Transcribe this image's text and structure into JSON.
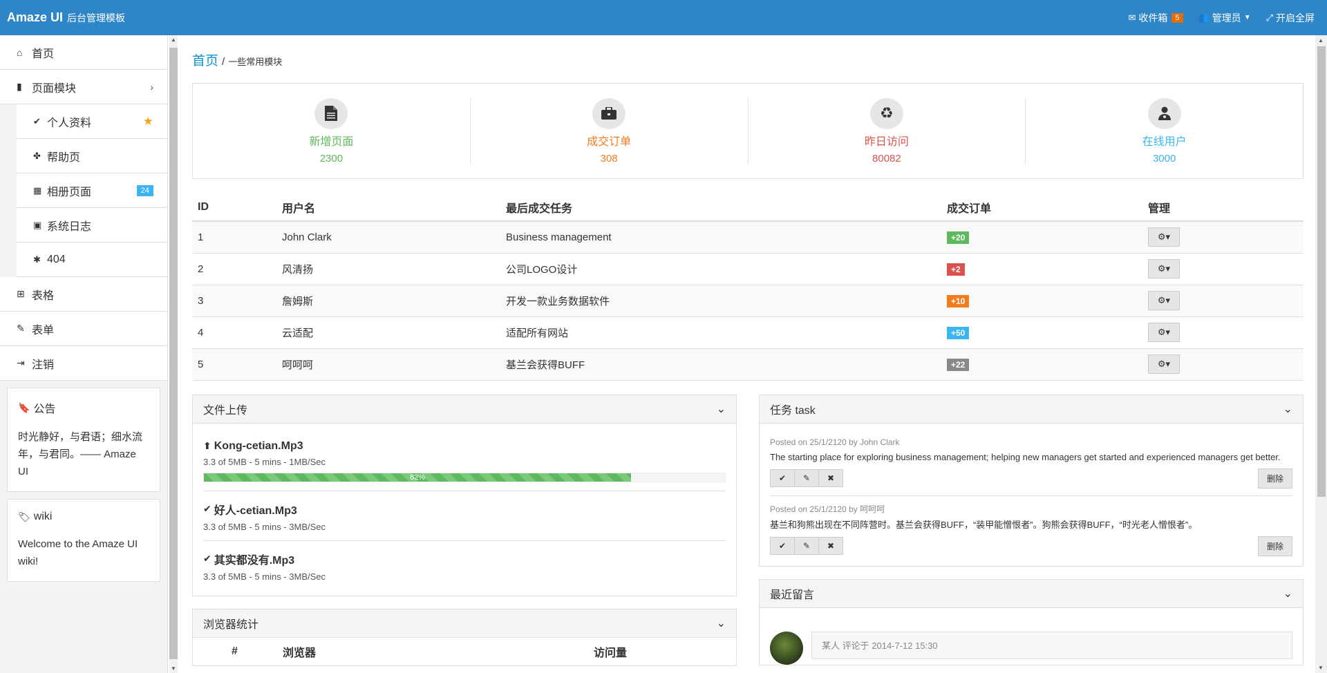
{
  "header": {
    "brand": "Amaze UI",
    "brand_sub": "后台管理模板",
    "inbox_label": "收件箱",
    "inbox_count": "5",
    "admin_label": "管理员",
    "fullscreen_label": "开启全屏"
  },
  "sidebar": {
    "items": [
      {
        "label": "首页",
        "icon": "home-icon"
      },
      {
        "label": "页面模块",
        "icon": "file-icon"
      }
    ],
    "sub_items": [
      {
        "label": "个人资料",
        "icon": "check-icon"
      },
      {
        "label": "帮助页",
        "icon": "puzzle-icon"
      },
      {
        "label": "相册页面",
        "icon": "th-icon",
        "badge": "24"
      },
      {
        "label": "系统日志",
        "icon": "calendar-icon"
      },
      {
        "label": "404",
        "icon": "bug-icon"
      }
    ],
    "items2": [
      {
        "label": "表格",
        "icon": "table-icon"
      },
      {
        "label": "表单",
        "icon": "edit-icon"
      },
      {
        "label": "注销",
        "icon": "sign-out-icon"
      }
    ],
    "notice": {
      "title": "公告",
      "text": "时光静好，与君语；细水流年，与君同。—— Amaze UI"
    },
    "wiki": {
      "title": "wiki",
      "text": "Welcome to the Amaze UI wiki!"
    }
  },
  "breadcrumb": {
    "home": "首页",
    "sep": "/",
    "current": "一些常用模块"
  },
  "stats": [
    {
      "label": "新增页面",
      "value": "2300",
      "color": "#5eb95e",
      "icon": "file-text-icon"
    },
    {
      "label": "成交订单",
      "value": "308",
      "color": "#f37b1d",
      "icon": "briefcase-icon"
    },
    {
      "label": "昨日访问",
      "value": "80082",
      "color": "#dd514c",
      "icon": "recycle-icon"
    },
    {
      "label": "在线用户",
      "value": "3000",
      "color": "#3bb4f2",
      "icon": "user-md-icon"
    }
  ],
  "table": {
    "headers": [
      "ID",
      "用户名",
      "最后成交任务",
      "成交订单",
      "管理"
    ],
    "rows": [
      {
        "id": "1",
        "user": "John Clark",
        "task": "Business management",
        "orders": "+20",
        "color": "#5eb95e"
      },
      {
        "id": "2",
        "user": "风清扬",
        "task": "公司LOGO设计",
        "orders": "+2",
        "color": "#dd514c"
      },
      {
        "id": "3",
        "user": "詹姆斯",
        "task": "开发一款业务数据软件",
        "orders": "+10",
        "color": "#f37b1d"
      },
      {
        "id": "4",
        "user": "云适配",
        "task": "适配所有网站",
        "orders": "+50",
        "color": "#3bb4f2"
      },
      {
        "id": "5",
        "user": "呵呵呵",
        "task": "基兰会获得BUFF",
        "orders": "+22",
        "color": "#888888"
      }
    ]
  },
  "upload": {
    "title": "文件上传",
    "items": [
      {
        "name": "Kong-cetian.Mp3",
        "meta": "3.3 of 5MB - 5 mins - 1MB/Sec",
        "progress": 82,
        "progress_label": "82%"
      },
      {
        "name": "好人-cetian.Mp3",
        "meta": "3.3 of 5MB - 5 mins - 3MB/Sec"
      },
      {
        "name": "其实都没有.Mp3",
        "meta": "3.3 of 5MB - 5 mins - 3MB/Sec"
      }
    ]
  },
  "browser": {
    "title": "浏览器统计",
    "headers": [
      "#",
      "浏览器",
      "访问量"
    ]
  },
  "tasks": {
    "title": "任务 task",
    "items": [
      {
        "meta_prefix": "Posted on 25/1/2120 by ",
        "author": "John Clark",
        "text": "The starting place for exploring business management; helping new managers get started and experienced managers get better.",
        "delete": "删除"
      },
      {
        "meta_prefix": "Posted on 25/1/2120 by ",
        "author": "呵呵呵",
        "text": "基兰和狗熊出现在不同阵营时。基兰会获得BUFF，“装甲能憎恨者”。狗熊会获得BUFF，“时光老人憎恨者”。",
        "delete": "删除"
      }
    ]
  },
  "comments": {
    "title": "最近留言",
    "first": {
      "author": "某人",
      "meta": "评论于 2014-7-12 15:30"
    }
  }
}
